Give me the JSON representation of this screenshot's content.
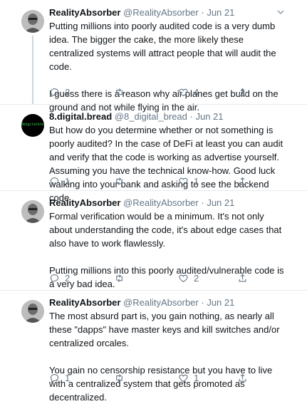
{
  "tweets": [
    {
      "name": "RealityAbsorber",
      "handle": "@RealityAbsorber",
      "sep": "·",
      "date": "Jun 21",
      "paragraphs": [
        "Putting millions into poorly audited code is a very dumb idea. The bigger the cake, the more likely these centralized systems will attract people that will audit the code.",
        "I guess there is a reason why air planes get build on the ground and not while flying in the air."
      ],
      "replies": "2",
      "retweets": "",
      "likes": "4"
    },
    {
      "name": "8.digital.bread",
      "handle": "@8_digital_bread",
      "sep": "·",
      "date": "Jun 21",
      "avatar_text": "8digitalbread",
      "paragraphs": [
        "But how do you determine whether or not something is poorly audited? In the case of DeFi at least you can audit and verify that the code is working as advertise yourself. Assuming you have the technical know-how. Good luck walking into your bank and asking to see the backend code"
      ],
      "replies": "1",
      "retweets": "",
      "likes": "1"
    },
    {
      "name": "RealityAbsorber",
      "handle": "@RealityAbsorber",
      "sep": "·",
      "date": "Jun 21",
      "paragraphs": [
        "Formal verification would be a minimum. It's not only about understanding the code, it's about edge cases that also have to work flawlessly.",
        "Putting millions into this poorly audited/vulnerable code is a very bad idea."
      ],
      "replies": "2",
      "retweets": "",
      "likes": "2"
    },
    {
      "name": "RealityAbsorber",
      "handle": "@RealityAbsorber",
      "sep": "·",
      "date": "Jun 21",
      "paragraphs": [
        "The most absurd part is, you gain nothing, as nearly all these \"dapps\" have master keys and kill switches and/or centralized orcales.",
        "You gain no censorship resistance but you have to live with a centralized system that gets promoted as decentralized."
      ],
      "replies": "1",
      "retweets": "",
      "likes": "1"
    }
  ],
  "icons": {
    "reply": "reply-icon",
    "retweet": "retweet-icon",
    "like": "heart-icon",
    "share": "share-icon",
    "more": "chevron-down-icon"
  },
  "colors": {
    "muted": "#657786",
    "text": "#0f1419",
    "divider": "#e6ecf0"
  }
}
